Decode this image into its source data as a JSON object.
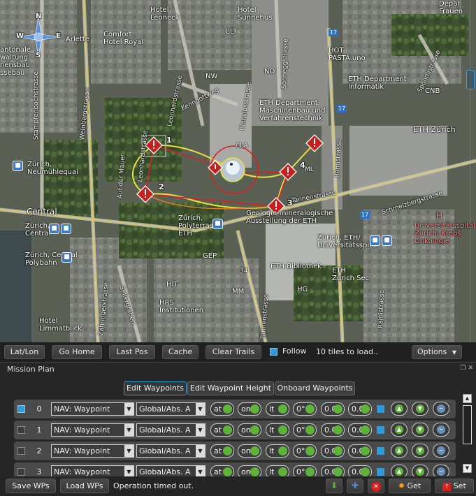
{
  "map": {
    "places": {
      "hotel_leoneck": "Hotel\nLeoneck",
      "hotel_sunnehus": "Hotel\nSunnehus",
      "clt": "CLT",
      "hot_pasta": "HOT\nPASTA uno",
      "no": "NO",
      "nw": "NW",
      "eth_informatik": "ETH Department\nInformatik",
      "cnb": "CNB",
      "eth_maschinenbau": "ETH Department\nMaschinenbau und\nVerfahrenstechnik",
      "eth_zurich": "ETH Zürich",
      "cla": "CLA",
      "ml": "ML",
      "comfort_hotel": "Comfort\nHotel Royal",
      "arlette": "Arlette",
      "kantonale": "antonale\nwaltung\nnensbau\nssebau",
      "neumuhlequai": "Zürich,\nNeumühlequai",
      "central": "Central",
      "zurich_central": "Zürich,\nCentral",
      "polybahn": "Zürich, Central\nPolybahn",
      "polyterrasse": "Zürich,\nPolyterrasse\nETH",
      "gep": "GEP",
      "geologie": "Geologie-mineralogische\nAusstellung der ETH",
      "eth_universitatsspital": "Zürich, ETH/\nUniversitätsspital",
      "universitatsspital": "Universitätsspital\nZürich, Krebs\nOnkologie",
      "eth_bibliothek": "ETH-Bibliothek",
      "eth_zurich_sec": "ETH\nZürich Sec",
      "hg": "HG",
      "hit": "HIT",
      "hrs": "HRS\nInstitutionen",
      "mm": "MM",
      "hotel_limmatblick": "Hotel\nLimmatblick",
      "depar": "Depar\nFrauen",
      "h_marker": "H"
    },
    "streets": {
      "stampfenbachstrasse": "Stampfenbachstrasse",
      "weinbergstrasse": "Weinbergstrasse",
      "leonhardstrasse": "Leonhardstrasse",
      "kenngottweg": "Kenngottweg",
      "clausiusstrasse": "Clausiusstrasse",
      "sonneggstrasse": "Sonneggstrasse",
      "spoendlistrasse": "Spöndlistrasse",
      "auf_der_mauer": "Auf der Mauer",
      "tannenstrasse": "Tannenstrasse",
      "ramistrasse": "Rämistrasse",
      "schmelzbergstrasse": "Schmelzbergstrasse",
      "zahringerstrasse": "Zähringerstrasse",
      "seilergraben": "Seilergraben",
      "leonhardstrasse2": "Leonhardstrasse",
      "ramistrasse2": "Rämistrasse",
      "tannenstrasse2": "Tannenstrasse"
    },
    "route_badges": [
      "17",
      "17",
      "17"
    ],
    "road_number": "34",
    "compass": {
      "n": "N",
      "s": "S",
      "w": "W",
      "e": "E"
    },
    "waypoint_numbers": [
      "1",
      "2",
      "3",
      "4"
    ]
  },
  "map_toolbar": {
    "latlon": "Lat/Lon",
    "go_home": "Go Home",
    "last_pos": "Last Pos",
    "cache": "Cache",
    "clear_trails": "Clear Trails",
    "follow": "Follow",
    "tiles_status": "10 tiles to load..",
    "options": "Options"
  },
  "mission": {
    "title": "Mission Plan",
    "tabs": [
      "Edit Waypoints",
      "Edit Waypoint Height",
      "Onboard Waypoints"
    ],
    "rows": [
      {
        "idx": "0",
        "cmd": "NAV: Waypoint",
        "frame": "Global/Abs. A",
        "f1": "at",
        "f2": "on",
        "f3": "lt",
        "f4": "0°",
        "f5": "0.0",
        "f6": "0.0",
        "checked": true
      },
      {
        "idx": "1",
        "cmd": "NAV: Waypoint",
        "frame": "Global/Abs. A",
        "f1": "at",
        "f2": "on",
        "f3": "lt",
        "f4": "0°",
        "f5": "0.0",
        "f6": "0.0",
        "checked": false
      },
      {
        "idx": "2",
        "cmd": "NAV: Waypoint",
        "frame": "Global/Abs. A",
        "f1": "at",
        "f2": "on",
        "f3": "lt",
        "f4": "0°",
        "f5": "0.0",
        "f6": "0.0",
        "checked": false
      },
      {
        "idx": "3",
        "cmd": "NAV: Waypoint",
        "frame": "Global/Abs. A",
        "f1": "at",
        "f2": "on",
        "f3": "lt",
        "f4": "0°",
        "f5": "0.0",
        "f6": "0.0",
        "checked": false
      }
    ]
  },
  "bottom": {
    "save_wps": "Save WPs",
    "load_wps": "Load WPs",
    "status": "Operation timed out.",
    "get": "Get",
    "set": "Set"
  },
  "colors": {
    "accent": "#2e9ad6",
    "spin_green": "#5fb33a",
    "waypoint_red": "#cc2222",
    "trail_yellow": "#e8e040"
  }
}
